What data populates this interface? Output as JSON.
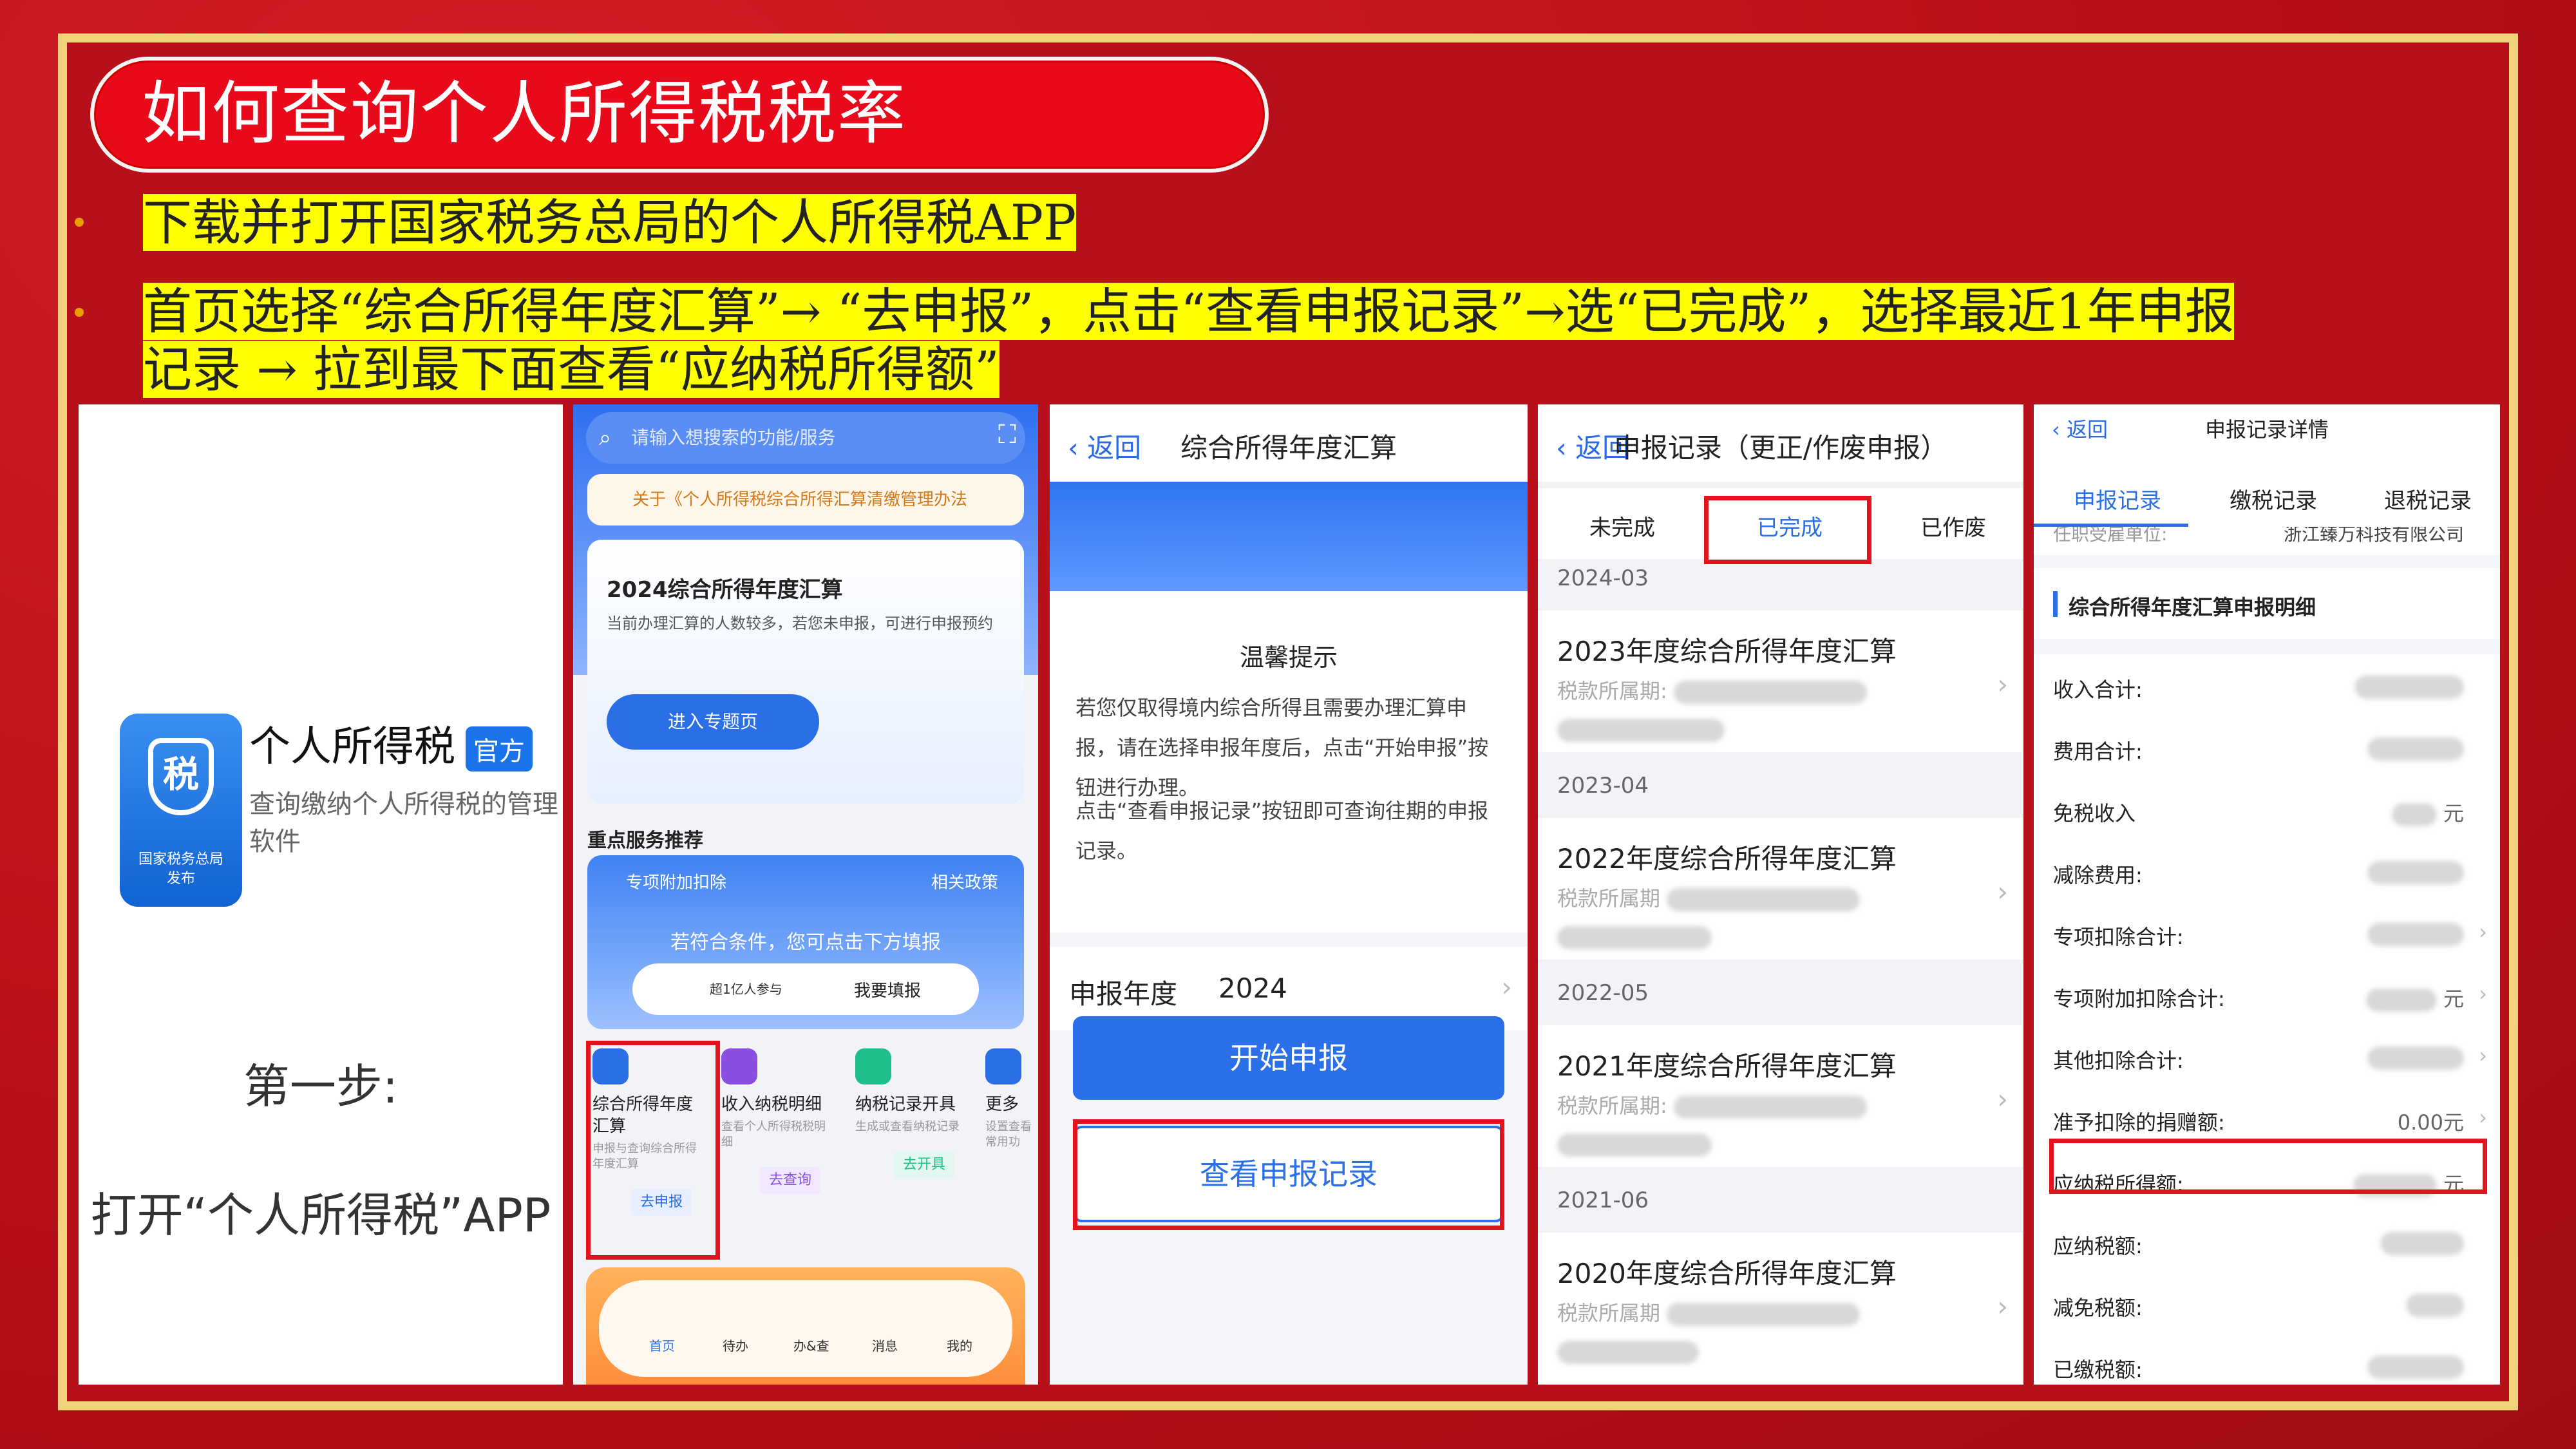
{
  "title": "如何查询个人所得税税率",
  "bullets": [
    "下载并打开国家税务总局的个人所得税APP",
    "首页选择“综合所得年度汇算”→ “去申报”，点击“查看申报记录”→选“已完成”，选择最近1年申报",
    "记录 → 拉到最下面查看“应纳税所得额”"
  ],
  "panel1": {
    "app_icon_char": "税",
    "app_icon_sub": "国家税务总局\n发布",
    "app_name": "个人所得税",
    "badge": "官方",
    "app_desc": "查询缴纳个人所得税的管理软件",
    "step_title": "第一步:",
    "step_text": "打开“个人所得税”APP"
  },
  "panel2": {
    "search_placeholder": "请输入想搜索的功能/服务",
    "notice": "关于《个人所得税综合所得汇算清缴管理办法",
    "banner_title": "2024综合所得年度汇算",
    "banner_desc": "当前办理汇算的人数较多，若您未申报，可进行申报预约",
    "banner_button": "进入专题页",
    "section_title": "重点服务推荐",
    "service_card": {
      "title": "专项附加扣除",
      "policy": "相关政策",
      "prompt": "若符合条件，您可点击下方填报",
      "participants": "超1亿人参与",
      "action": "我要填报"
    },
    "entries": [
      {
        "title": "综合所得年度汇算",
        "desc": "申报与查询综合所得年度汇算",
        "go": "去申报",
        "color": "#2b6fe6"
      },
      {
        "title": "收入纳税明细",
        "desc": "查看个人所得税税明细",
        "go": "去查询",
        "color": "#8a4fe0"
      },
      {
        "title": "纳税记录开具",
        "desc": "生成或查看纳税记录",
        "go": "去开具",
        "color": "#1dbf8b"
      },
      {
        "title": "更多",
        "desc": "设置查看常用功",
        "go": "",
        "color": "#2b6fe6"
      }
    ],
    "nav": [
      "首页",
      "待办",
      "办&查",
      "消息",
      "我的"
    ]
  },
  "panel3": {
    "back": "返回",
    "title": "综合所得年度汇算",
    "tips_title": "温馨提示",
    "tip1": "若您仅取得境内综合所得且需要办理汇算申报，请在选择申报年度后，点击“开始申报”按钮进行办理。",
    "tip2": "点击“查看申报记录”按钮即可查询往期的申报记录。",
    "year_label": "申报年度",
    "year_value": "2024",
    "start_button": "开始申报",
    "records_button": "查看申报记录"
  },
  "panel4": {
    "back": "返回",
    "title": "申报记录（更正/作废申报）",
    "tabs": [
      "未完成",
      "已完成",
      "已作废"
    ],
    "records": [
      {
        "date": "2024-03",
        "title": "2023年度综合所得年度汇算",
        "period": "税款所属期:"
      },
      {
        "date": "2023-04",
        "title": "2022年度综合所得年度汇算",
        "period": "税款所属期"
      },
      {
        "date": "2022-05",
        "title": "2021年度综合所得年度汇算",
        "period": "税款所属期:"
      },
      {
        "date": "2021-06",
        "title": "2020年度综合所得年度汇算",
        "period": "税款所属期"
      }
    ]
  },
  "panel5": {
    "back": "返回",
    "title": "申报记录详情",
    "tabs": [
      "申报记录",
      "缴税记录",
      "退税记录"
    ],
    "company": "浙江臻万科技有限公司",
    "employer_label": "任职受雇单位:",
    "section": "综合所得年度汇算申报明细",
    "rows": [
      {
        "label": "收入合计:",
        "value": ""
      },
      {
        "label": "费用合计:",
        "value": ""
      },
      {
        "label": "免税收入",
        "value": "元"
      },
      {
        "label": "减除费用:",
        "value": ""
      },
      {
        "label": "专项扣除合计:",
        "value": ""
      },
      {
        "label": "专项附加扣除合计:",
        "value": "元"
      },
      {
        "label": "其他扣除合计:",
        "value": ""
      },
      {
        "label": "准予扣除的捐赠额:",
        "value": "0.00元"
      },
      {
        "label": "应纳税所得额:",
        "value": "元"
      },
      {
        "label": "应纳税额:",
        "value": ""
      },
      {
        "label": "减免税额:",
        "value": ""
      },
      {
        "label": "已缴税额:",
        "value": ""
      }
    ]
  }
}
